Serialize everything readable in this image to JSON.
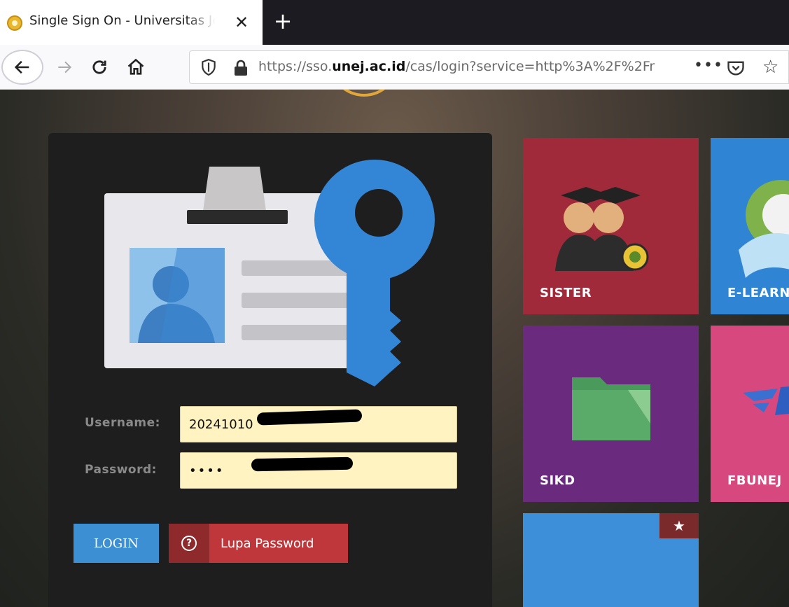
{
  "browser": {
    "tab_title": "Single Sign On - Universitas Jember",
    "tab_close": "✕",
    "new_tab": "+",
    "url_prefix": "https://sso.",
    "url_domain": "unej.ac.id",
    "url_path": "/cas/login?service=http%3A%2F%2Fr",
    "more_label": "•••"
  },
  "login": {
    "username_label": "Username:",
    "username_value": "20241010",
    "password_label": "Password:",
    "password_value": "••••",
    "login_button": "LOGIN",
    "forgot_icon": "?",
    "forgot_button": "Lupa Password"
  },
  "tiles": {
    "sister": "SISTER",
    "elearn": "E-LEARN",
    "sikd": "SIKD",
    "fbunej": "FBUNEJ",
    "favorite_icon": "★"
  },
  "colors": {
    "login_button": "#3c8fd2",
    "forgot_button": "#c0373b",
    "tile_sister": "#a02a3a",
    "tile_elearn": "#2f84d4",
    "tile_sikd": "#6a2a7e",
    "tile_fbunej": "#d7487e",
    "input_background": "#fff3c2"
  }
}
